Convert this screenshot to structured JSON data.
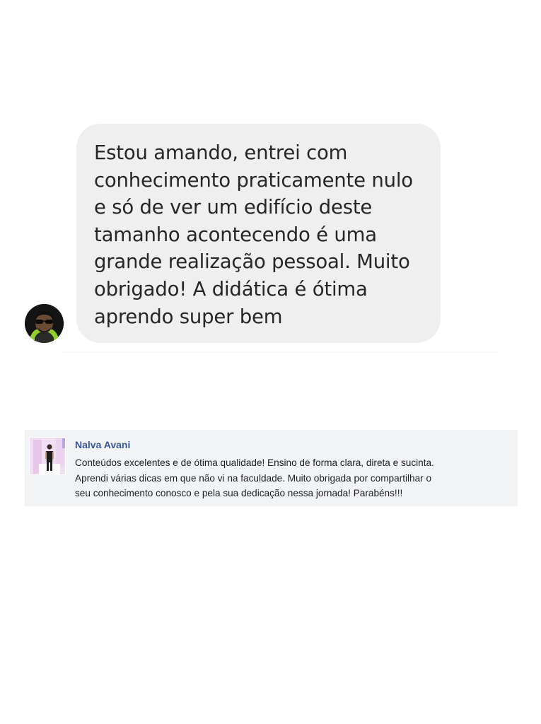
{
  "chat_testimonial": {
    "avatar_icon": "user-avatar-sunglasses",
    "bubble_color": "#efefef",
    "message": "Estou amando, entrei com conhecimento praticamente nulo e só de ver um edifício deste tamanho acontecendo é uma grande realização pessoal. Muito obrigado! A didática é ótima aprendo super bem"
  },
  "comment_testimonial": {
    "avatar_icon": "user-avatar-photo",
    "author": "Nalva Avani",
    "author_color": "#385898",
    "text_lines": [
      "Conteúdos excelentes e de ótima qualidade! Ensino de forma clara, direta e sucinta.",
      "Aprendi várias dicas em que não vi na faculdade. Muito obrigada por compartilhar o",
      "seu conhecimento conosco e pela sua dedicação nessa jornada! Parabéns!!!"
    ]
  }
}
